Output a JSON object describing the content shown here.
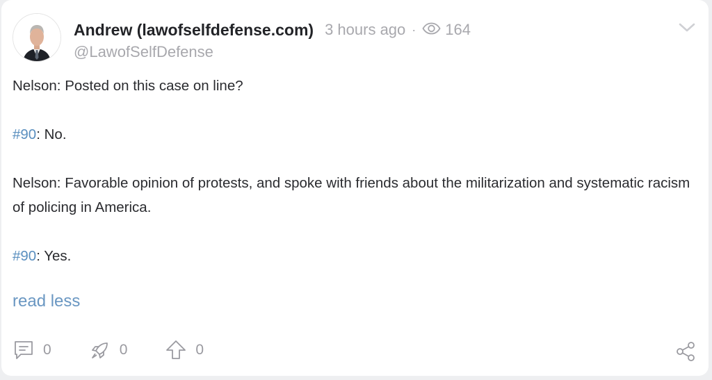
{
  "post": {
    "author_name": "Andrew (lawofselfdefense.com)",
    "timestamp": "3 hours ago",
    "separator": "·",
    "views": "164",
    "handle": "@LawofSelfDefense",
    "paragraphs": [
      {
        "text": "Nelson: Posted on this case on line?"
      },
      {
        "tag": "#90",
        "text": ": No."
      },
      {
        "text": "Nelson: Favorable opinion of protests, and spoke with friends about the militarization and systematic racism of policing in America."
      },
      {
        "tag": "#90",
        "text": ": Yes."
      }
    ],
    "read_less_label": "read less"
  },
  "actions": {
    "comments_count": "0",
    "reposts_count": "0",
    "upvotes_count": "0"
  },
  "icons": {
    "views": "eye-icon",
    "menu": "chevron-down-icon",
    "comment": "comment-icon",
    "repost": "rocket-icon",
    "upvote": "arrow-up-icon",
    "share": "share-icon"
  },
  "colors": {
    "link": "#5a8fbf",
    "muted": "#a8a8ad",
    "text": "#2a2b2f"
  }
}
